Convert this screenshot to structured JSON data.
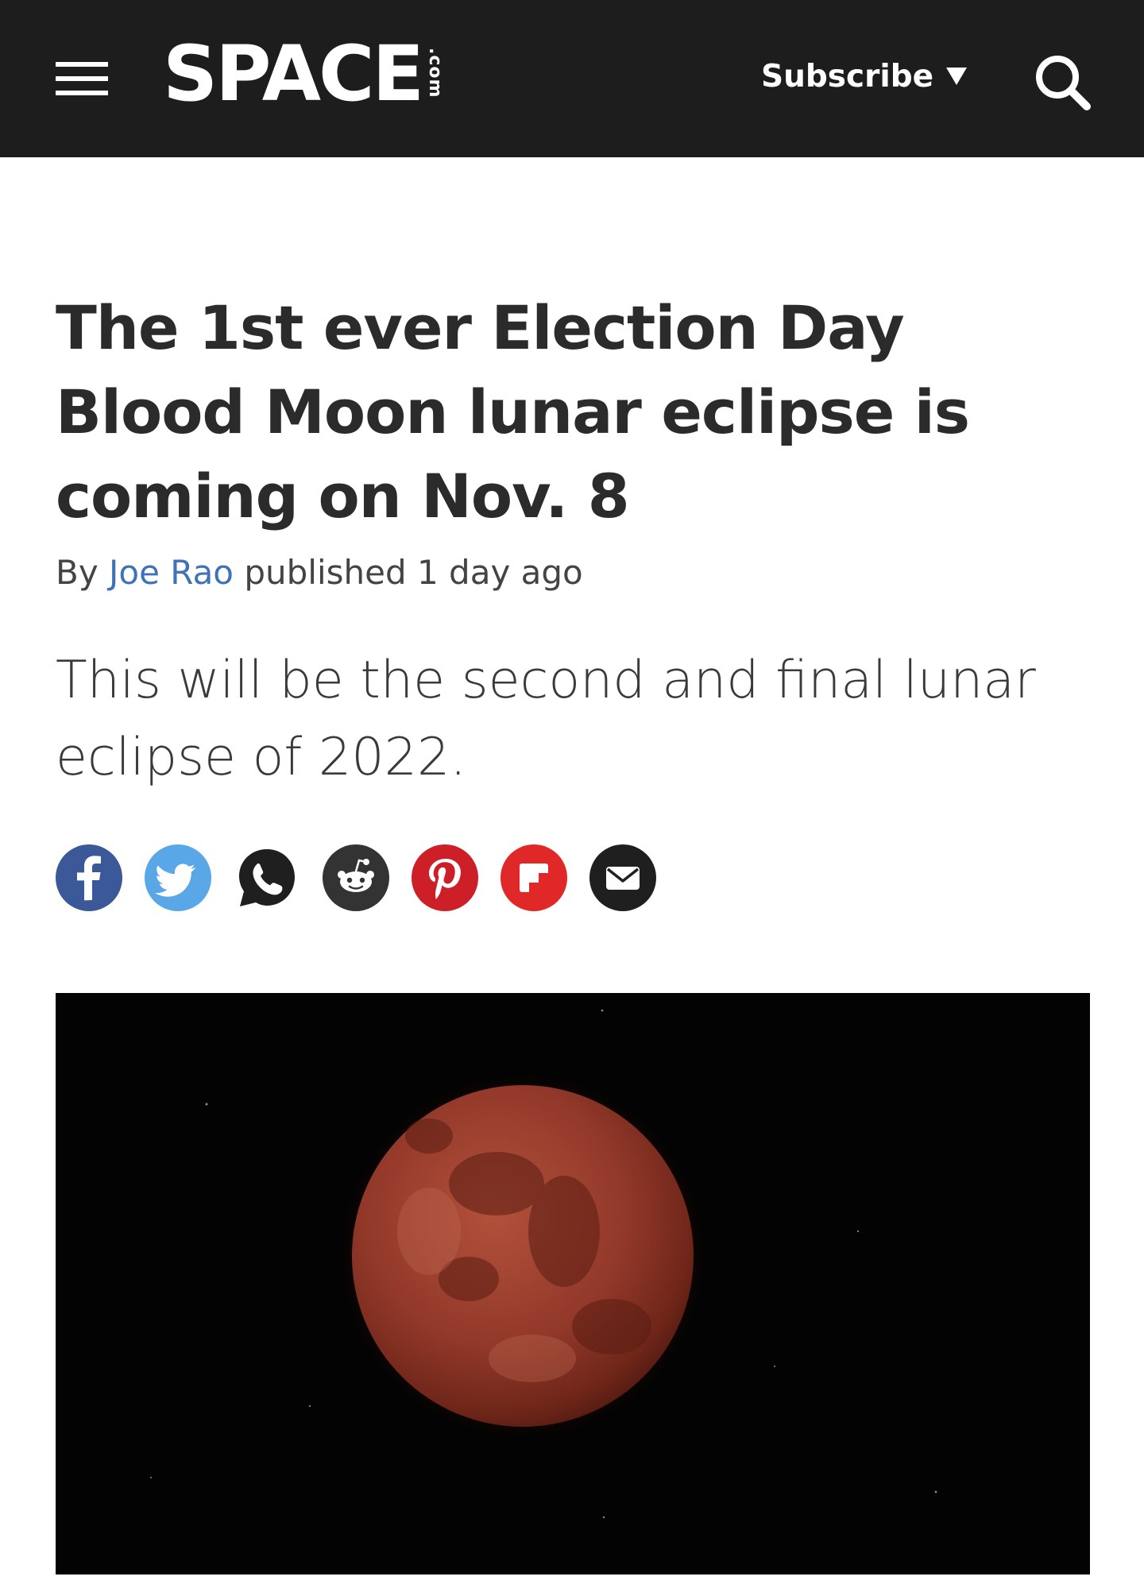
{
  "header": {
    "logo_main": "SPACE",
    "logo_suffix": ".com",
    "subscribe_label": "Subscribe",
    "background_color": "#1d1d1d"
  },
  "article": {
    "headline": "The 1st ever Election Day Blood Moon lunar eclipse is coming on Nov. 8",
    "byline": {
      "prefix": "By",
      "author": "Joe Rao",
      "published": "published 1 day ago"
    },
    "strapline": "This will be the second and final lunar eclipse of 2022."
  },
  "share": [
    {
      "name": "facebook",
      "icon": "facebook-icon",
      "color": "#3b5998"
    },
    {
      "name": "twitter",
      "icon": "twitter-icon",
      "color": "#5aa7e8"
    },
    {
      "name": "whatsapp",
      "icon": "whatsapp-icon",
      "color": "#1f1f1f"
    },
    {
      "name": "reddit",
      "icon": "reddit-icon",
      "color": "#333333"
    },
    {
      "name": "pinterest",
      "icon": "pinterest-icon",
      "color": "#cc1f27"
    },
    {
      "name": "flipboard",
      "icon": "flipboard-icon",
      "color": "#e12828"
    },
    {
      "name": "email",
      "icon": "email-icon",
      "color": "#1f1f1f"
    }
  ],
  "hero_image": {
    "subject": "blood-moon-eclipse-photo",
    "moon_color": "#9a3b2a"
  },
  "colors": {
    "author_link": "#3f72b8",
    "text": "#2b2b2b"
  }
}
